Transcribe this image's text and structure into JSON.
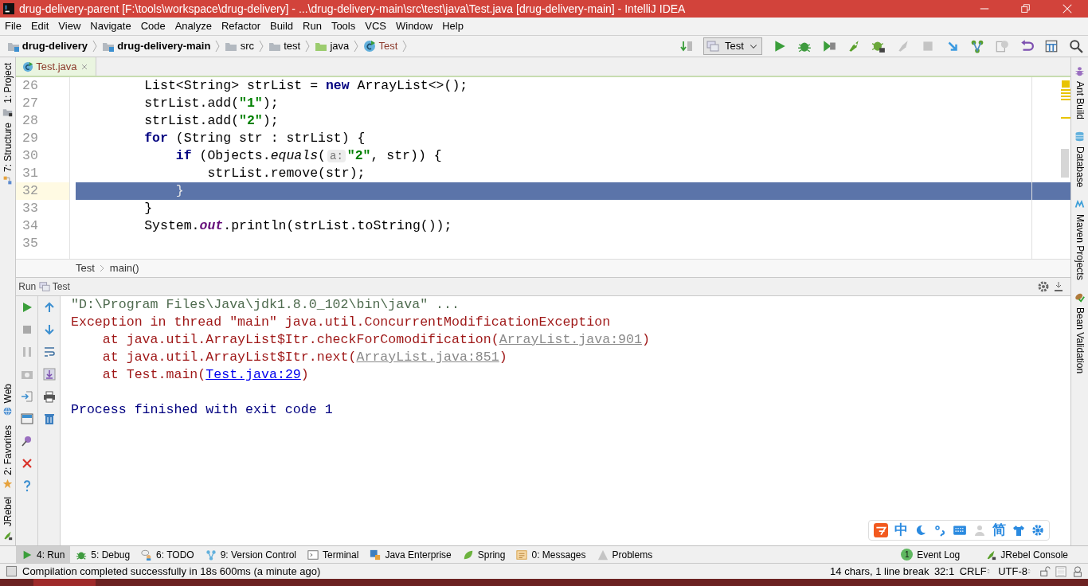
{
  "window": {
    "title": "drug-delivery-parent [F:\\tools\\workspace\\drug-delivery] - ...\\drug-delivery-main\\src\\test\\java\\Test.java [drug-delivery-main] - IntelliJ IDEA"
  },
  "menu": [
    "File",
    "Edit",
    "View",
    "Navigate",
    "Code",
    "Analyze",
    "Refactor",
    "Build",
    "Run",
    "Tools",
    "VCS",
    "Window",
    "Help"
  ],
  "navigation": [
    {
      "label": "drug-delivery",
      "kind": "module"
    },
    {
      "label": "drug-delivery-main",
      "kind": "module"
    },
    {
      "label": "src",
      "kind": "folder"
    },
    {
      "label": "test",
      "kind": "folder"
    },
    {
      "label": "java",
      "kind": "source"
    },
    {
      "label": "Test",
      "kind": "class"
    }
  ],
  "run_config": {
    "label": "Test"
  },
  "left_tool_windows_top": [
    "1: Project",
    "7: Structure"
  ],
  "left_tool_windows_bottom": [
    "Web",
    "2: Favorites",
    "JRebel"
  ],
  "right_tool_windows": [
    {
      "label": "Ant Build",
      "kind": "ant"
    },
    {
      "label": "Database",
      "kind": "database"
    },
    {
      "label": "Maven Projects",
      "kind": "maven"
    },
    {
      "label": "Bean Validation",
      "kind": "bean"
    }
  ],
  "editor_tabs": [
    {
      "label": "Test.java",
      "selected": true
    }
  ],
  "editor": {
    "lines": [
      {
        "number": "26",
        "selected": false,
        "tokens": [
          {
            "kind": "plain",
            "text": "        List<String> strList = "
          },
          {
            "kind": "keyword",
            "text": "new"
          },
          {
            "kind": "plain",
            "text": " ArrayList<>();"
          }
        ]
      },
      {
        "number": "27",
        "selected": false,
        "tokens": [
          {
            "kind": "plain",
            "text": "        strList.add("
          },
          {
            "kind": "string",
            "text": "\"1\""
          },
          {
            "kind": "plain",
            "text": ");"
          }
        ]
      },
      {
        "number": "28",
        "selected": false,
        "tokens": [
          {
            "kind": "plain",
            "text": "        strList.add("
          },
          {
            "kind": "string",
            "text": "\"2\""
          },
          {
            "kind": "plain",
            "text": ");"
          }
        ]
      },
      {
        "number": "29",
        "selected": false,
        "tokens": [
          {
            "kind": "keyword",
            "text": "        for"
          },
          {
            "kind": "plain",
            "text": " (String str : strList) {"
          }
        ]
      },
      {
        "number": "30",
        "selected": false,
        "tokens": [
          {
            "kind": "keyword",
            "text": "            if"
          },
          {
            "kind": "plain",
            "text": " (Objects."
          },
          {
            "kind": "method",
            "text": "equals"
          },
          {
            "kind": "plain",
            "text": "("
          },
          {
            "kind": "hint",
            "text": "a:"
          },
          {
            "kind": "string",
            "text": "\"2\""
          },
          {
            "kind": "plain",
            "text": ", str)) {"
          }
        ]
      },
      {
        "number": "31",
        "selected": false,
        "tokens": [
          {
            "kind": "plain",
            "text": "                strList.remove(str);"
          }
        ]
      },
      {
        "number": "32",
        "selected": true,
        "tokens": [
          {
            "kind": "plain",
            "text": "            }"
          }
        ]
      },
      {
        "number": "33",
        "selected": false,
        "tokens": [
          {
            "kind": "plain",
            "text": "        }"
          }
        ]
      },
      {
        "number": "34",
        "selected": false,
        "tokens": [
          {
            "kind": "plain",
            "text": "        System."
          },
          {
            "kind": "field",
            "text": "out"
          },
          {
            "kind": "plain",
            "text": ".println(strList.toString());"
          }
        ]
      },
      {
        "number": "35",
        "selected": false
      }
    ]
  },
  "editor_breadcrumb": [
    "Test",
    "main()"
  ],
  "run_panel": {
    "label": "Run",
    "tab": "Test",
    "console": [
      {
        "tokens": [
          {
            "kind": "command",
            "text": "\"D:\\Program Files\\Java\\jdk1.8.0_102\\bin\\java\" ..."
          }
        ]
      },
      {
        "tokens": [
          {
            "kind": "error",
            "text": "Exception in thread \"main\" java.util.ConcurrentModificationException"
          }
        ]
      },
      {
        "tokens": [
          {
            "kind": "error",
            "text": "    at java.util.ArrayList$Itr.checkForComodification("
          },
          {
            "kind": "library-link",
            "text": "ArrayList.java:901"
          },
          {
            "kind": "error",
            "text": ")"
          }
        ]
      },
      {
        "tokens": [
          {
            "kind": "error",
            "text": "    at java.util.ArrayList$Itr.next("
          },
          {
            "kind": "library-link",
            "text": "ArrayList.java:851"
          },
          {
            "kind": "error",
            "text": ")"
          }
        ]
      },
      {
        "tokens": [
          {
            "kind": "error",
            "text": "    at Test.main("
          },
          {
            "kind": "link",
            "text": "Test.java:29"
          },
          {
            "kind": "error",
            "text": ")"
          }
        ]
      },
      {
        "spaced": true,
        "tokens": [
          {
            "kind": "info",
            "text": "Process finished with exit code 1"
          }
        ]
      }
    ]
  },
  "tool_window_bar": [
    {
      "label": "4: Run",
      "kind": "run",
      "selected": true
    },
    {
      "label": "5: Debug",
      "kind": "debug",
      "selected": false
    },
    {
      "label": "6: TODO",
      "kind": "todo",
      "selected": false
    },
    {
      "label": "9: Version Control",
      "kind": "vcs",
      "selected": false
    },
    {
      "label": "Terminal",
      "kind": "terminal",
      "selected": false
    },
    {
      "label": "Java Enterprise",
      "kind": "javaee",
      "selected": false
    },
    {
      "label": "Spring",
      "kind": "spring",
      "selected": false
    },
    {
      "label": "0: Messages",
      "kind": "messages",
      "selected": false
    },
    {
      "label": "Problems",
      "kind": "problems",
      "selected": false
    }
  ],
  "tool_window_bar_right": [
    {
      "label": "Event Log",
      "kind": "eventlog",
      "badge": "1"
    },
    {
      "label": "JRebel Console",
      "kind": "jrebel"
    }
  ],
  "status_bar": {
    "message": "Compilation completed successfully in 18s 600ms (a minute ago)",
    "selection": "14 chars, 1 line break",
    "position": "32:1",
    "line_separator": "CRLF",
    "encoding": "UTF-8"
  },
  "ime_toolbar": {
    "mode": "中",
    "charset": "简"
  }
}
